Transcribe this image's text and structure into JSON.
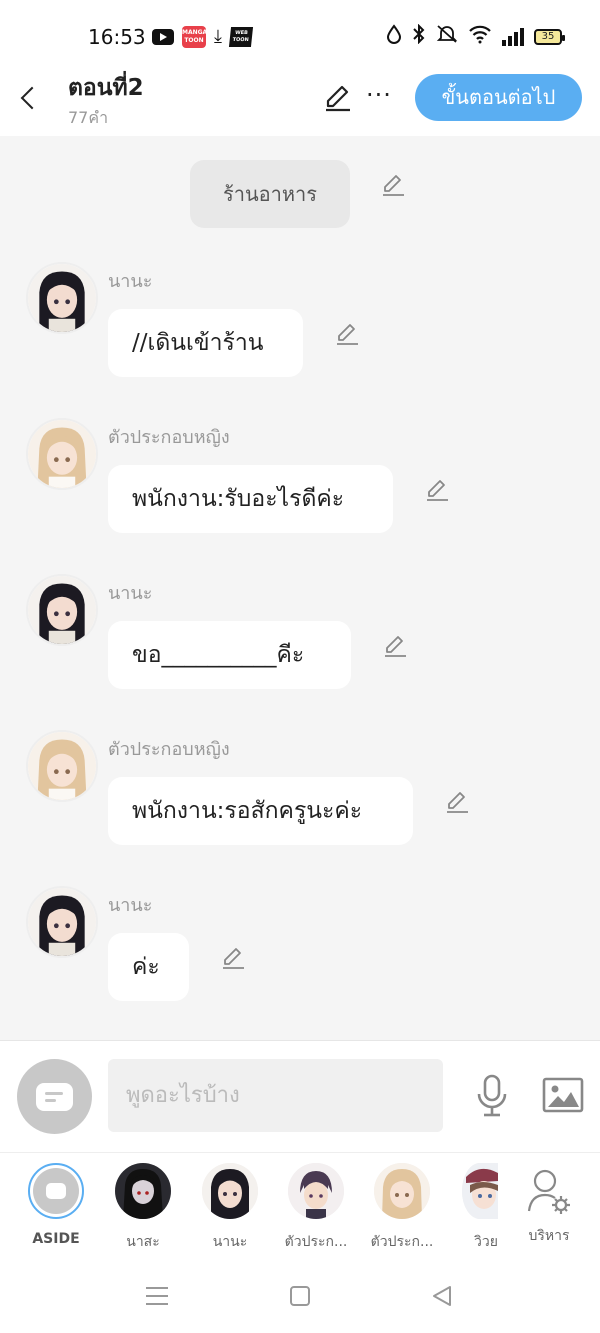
{
  "status_bar": {
    "time": "16:53",
    "app_icons": [
      "youtube-icon",
      "mangatoon-icon",
      "download-icon",
      "webtoon-icon"
    ],
    "manga_text": "MANGA\nTOON",
    "webtoon_text": "WEB\nTOON",
    "sys_icons": [
      "drop-icon",
      "bluetooth-icon",
      "mute-icon",
      "wifi-icon",
      "signal-icon"
    ],
    "battery": "35"
  },
  "header": {
    "title": "ตอนที่2",
    "word_count": "77คำ",
    "next_button": "ขั้นตอนต่อไป",
    "more": "···"
  },
  "scene": {
    "label": "ร้านอาหาร"
  },
  "messages": [
    {
      "speaker": "นานะ",
      "text": "//เดินเข้าร้าน",
      "avatar": "dark-hair-girl"
    },
    {
      "speaker": "ตัวประกอบหญิง",
      "text": "พนักงาน:รับอะไรดีค่ะ",
      "avatar": "blonde-girl"
    },
    {
      "speaker": "นานะ",
      "text": "ขอ__________คีะ",
      "avatar": "dark-hair-girl"
    },
    {
      "speaker": "ตัวประกอบหญิง",
      "text": "พนักงาน:รอสักครูนะค่ะ",
      "avatar": "blonde-girl"
    },
    {
      "speaker": "นานะ",
      "text": "ค่ะ",
      "avatar": "dark-hair-girl"
    }
  ],
  "input": {
    "placeholder": "พูดอะไรบ้าง"
  },
  "characters": [
    {
      "label": "ASIDE"
    },
    {
      "label": "นาสะ"
    },
    {
      "label": "นานะ"
    },
    {
      "label": "ตัวประก..."
    },
    {
      "label": "ตัวประก..."
    },
    {
      "label": "วิวย"
    },
    {
      "label": "บริหาร"
    }
  ],
  "colors": {
    "accent": "#5aaef2",
    "background": "#f5f5f5",
    "bubble": "#ffffff",
    "scene_chip": "#e8e8e8"
  }
}
